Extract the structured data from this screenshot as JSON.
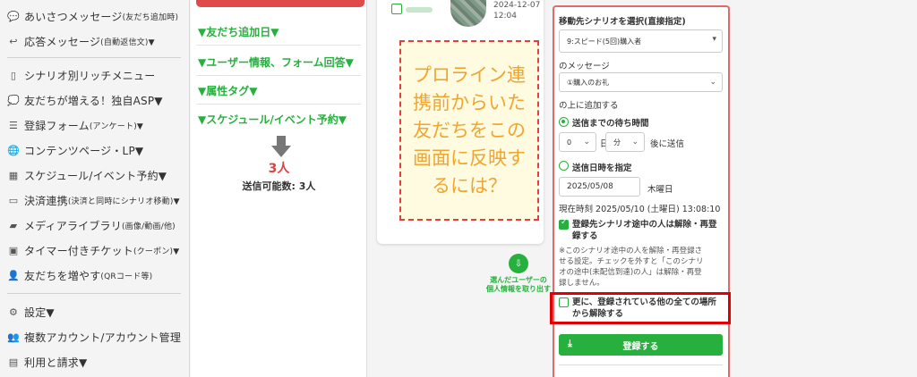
{
  "sidebar": {
    "items": [
      {
        "icon": "chat-bubble-icon",
        "glyph": "💬",
        "label": "あいさつメッセージ",
        "small": "(友だち追加時)"
      },
      {
        "icon": "reply-icon",
        "glyph": "↩",
        "label": "応答メッセージ",
        "small": "(自動返信文)▼"
      },
      {
        "icon": "smartphone-icon",
        "glyph": "▯",
        "label": "シナリオ別リッチメニュー",
        "small": ""
      },
      {
        "icon": "chat-multi-icon",
        "glyph": "💭",
        "label": "友だちが増える！独自ASP▼",
        "small": ""
      },
      {
        "icon": "list-icon",
        "glyph": "☰",
        "label": "登録フォーム",
        "small": "(アンケート)▼"
      },
      {
        "icon": "globe-icon",
        "glyph": "🌐",
        "label": "コンテンツページ・LP▼",
        "small": ""
      },
      {
        "icon": "calendar-icon",
        "glyph": "▦",
        "label": "スケジュール/イベント予約▼",
        "small": ""
      },
      {
        "icon": "credit-card-icon",
        "glyph": "▭",
        "label": "決済連携",
        "small": "(決済と同時にシナリオ移動)▼"
      },
      {
        "icon": "folder-icon",
        "glyph": "▰",
        "label": "メディアライブラリ",
        "small": "(画像/動画/他)"
      },
      {
        "icon": "ticket-icon",
        "glyph": "▣",
        "label": "タイマー付きチケット",
        "small": "(クーポン)▼"
      },
      {
        "icon": "add-user-icon",
        "glyph": "👤",
        "label": "友だちを増やす",
        "small": "(QRコード等)"
      },
      {
        "icon": "gear-icon",
        "glyph": "⚙",
        "label": "設定▼",
        "small": ""
      },
      {
        "icon": "accounts-icon",
        "glyph": "👥",
        "label": "複数アカウント/アカウント管理",
        "small": ""
      },
      {
        "icon": "billing-icon",
        "glyph": "▤",
        "label": "利用と請求▼",
        "small": ""
      }
    ]
  },
  "filters": {
    "items": [
      "▼友だち追加日▼",
      "▼ユーザー情報、フォーム回答▼",
      "▼属性タグ▼",
      "▼スケジュール/イベント予約▼"
    ],
    "count": "3人",
    "sendable": "送信可能数: 3人"
  },
  "user_card": {
    "date": "2024-12-07",
    "time": "12:04",
    "note": "プロライン連携前からいた友だちをこの画面に反映するには？"
  },
  "export": {
    "label_line1": "選んだユーザーの",
    "label_line2": "個人情報を取り出す"
  },
  "panel": {
    "scenario_label": "移動先シナリオを選択(直接指定)",
    "scenario_value": "9:スピード(5回)購入者",
    "message_label": "のメッセージ",
    "message_value": "①購入のお礼",
    "add_above": "の上に追加する",
    "wait_radio": "送信までの待ち時間",
    "days_value": "0",
    "days_unit": "日",
    "minutes_value": "分",
    "after_send": "後に送信",
    "datetime_radio": "送信日時を指定",
    "date_value": "2025/05/08",
    "weekday": "木曜日",
    "now": "現在時刻 2025/05/10 (土曜日) 13:08:10",
    "cb1_line1": "登録先シナリオ途中の人は解除・再登",
    "cb1_line2": "録する",
    "note1": "※このシナリオ途中の人を解除・再登録さ",
    "note2": "せる設定。チェックを外すと「このシナリ",
    "note3": "オの途中(未配信到達)の人」は解除・再登",
    "note4": "録しません。",
    "cb2_line1": "更に、登録されている他の全ての場所",
    "cb2_line2": "から解除する",
    "register": "登録する"
  }
}
